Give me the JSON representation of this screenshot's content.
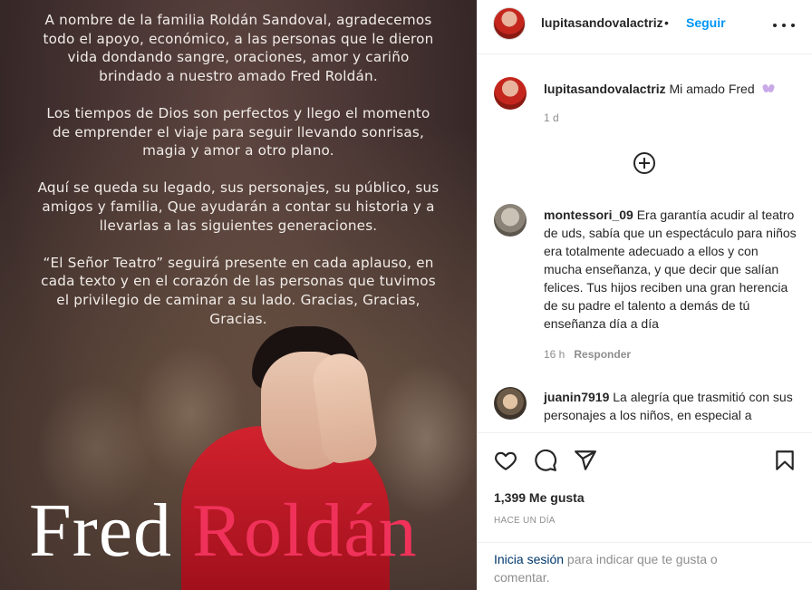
{
  "post_image": {
    "tribute_paragraphs": [
      "A nombre de la familia Roldán Sandoval, agradecemos todo el apoyo, económico, a las personas que le dieron vida dondando sangre, oraciones, amor y cariño brindado a nuestro amado Fred Roldán.",
      "Los tiempos de Dios son perfectos y llego el momento de emprender el viaje para seguir llevando sonrisas, magia y amor a otro plano.",
      "Aquí se queda su legado, sus personajes, su público, sus amigos y familia, Que ayudarán a contar su historia y a llevarlas a las siguientes generaciones.",
      "“El Señor Teatro” seguirá presente en cada aplauso, en cada texto y en el corazón de las personas que tuvimos el privilegio de caminar a su lado. Gracias, Gracias, Gracias."
    ],
    "name_first": "Fred",
    "name_last": "Roldán",
    "name_first_color": "#ffffff",
    "name_last_color": "#f0325a"
  },
  "header": {
    "username": "lupitasandovalactriz",
    "separator": "•",
    "follow_label": "Seguir",
    "follow_color": "#0095f6",
    "more_icon": "more-options-icon"
  },
  "caption": {
    "username": "lupitasandovalactriz",
    "text": "Mi amado Fred",
    "emoji_icon": "ribbon-bow-icon",
    "time": "1 d"
  },
  "comments": [
    {
      "username": "montessori_09",
      "text": "Era garantía acudir al teatro de uds, sabía que un espectáculo para niños era totalmente adecuado a ellos y con mucha enseñanza, y que decir que salían felices. Tus hijos reciben una gran herencia de su padre el talento a demás de tú enseñanza día a día",
      "time": "16 h",
      "reply_label": "Responder"
    },
    {
      "username": "juanin7919",
      "text": "La alegría que trasmitió con sus personajes a los niños, en especial a",
      "time": "",
      "reply_label": ""
    }
  ],
  "actions": {
    "like_icon": "heart-icon",
    "comment_icon": "comment-bubble-icon",
    "share_icon": "paper-plane-icon",
    "save_icon": "bookmark-icon",
    "likes_text": "1,399 Me gusta",
    "time_ago": "HACE UN DÍA"
  },
  "login_prompt": {
    "link_text": "Inicia sesión",
    "rest_text": " para indicar que te gusta o comentar."
  }
}
